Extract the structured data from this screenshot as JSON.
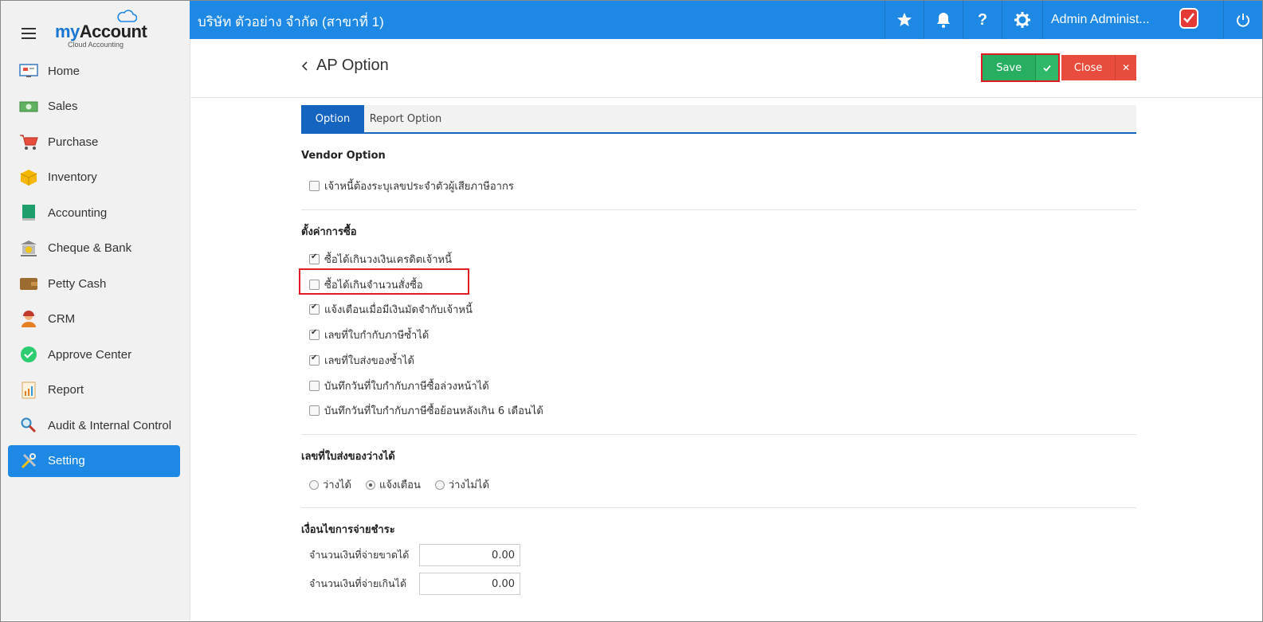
{
  "logo": {
    "brand_my": "my",
    "brand_account": "Account",
    "subtitle": "Cloud Accounting"
  },
  "sidebar": {
    "items": [
      {
        "label": "Home",
        "icon": "home-icon"
      },
      {
        "label": "Sales",
        "icon": "money-icon"
      },
      {
        "label": "Purchase",
        "icon": "cart-icon"
      },
      {
        "label": "Inventory",
        "icon": "box-icon"
      },
      {
        "label": "Accounting",
        "icon": "book-icon"
      },
      {
        "label": "Cheque & Bank",
        "icon": "bank-icon"
      },
      {
        "label": "Petty Cash",
        "icon": "wallet-icon"
      },
      {
        "label": "CRM",
        "icon": "person-icon"
      },
      {
        "label": "Approve Center",
        "icon": "check-circle-icon"
      },
      {
        "label": "Report",
        "icon": "report-icon"
      },
      {
        "label": "Audit & Internal Control",
        "icon": "magnifier-icon"
      },
      {
        "label": "Setting",
        "icon": "tools-icon",
        "active": true
      }
    ]
  },
  "topbar": {
    "company": "บริษัท ตัวอย่าง จำกัด (สาขาที่ 1)",
    "user_name": "Admin Administ..."
  },
  "header": {
    "title": "AP Option",
    "save_label": "Save",
    "close_label": "Close"
  },
  "tabs": [
    {
      "label": "Option",
      "active": true
    },
    {
      "label": "Report Option",
      "active": false
    }
  ],
  "vendor_option": {
    "title": "Vendor Option",
    "items": [
      {
        "label": "เจ้าหนี้ต้องระบุเลขประจำตัวผู้เสียภาษีอากร",
        "checked": false
      }
    ]
  },
  "purchase_settings": {
    "title": "ตั้งค่าการซื้อ",
    "items": [
      {
        "label": "ซื้อได้เกินวงเงินเครดิตเจ้าหนี้",
        "checked": true
      },
      {
        "label": "ซื้อได้เกินจำนวนสั่งซื้อ",
        "checked": false
      },
      {
        "label": "แจ้งเตือนเมื่อมีเงินมัดจำกับเจ้าหนี้",
        "checked": true
      },
      {
        "label": "เลขที่ใบกำกับภาษีซ้ำได้",
        "checked": true
      },
      {
        "label": "เลขที่ใบส่งของซ้ำได้",
        "checked": true
      },
      {
        "label": "บันทึกวันที่ใบกำกับภาษีซื้อล่วงหน้าได้",
        "checked": false
      },
      {
        "label": "บันทึกวันที่ใบกำกับภาษีซื้อย้อนหลังเกิน 6 เดือนได้",
        "checked": false
      }
    ]
  },
  "delivery_blank": {
    "title": "เลขที่ใบส่งของว่างได้",
    "options": [
      {
        "label": "ว่างได้",
        "selected": false
      },
      {
        "label": "แจ้งเตือน",
        "selected": true
      },
      {
        "label": "ว่างไม่ได้",
        "selected": false
      }
    ]
  },
  "payment_terms": {
    "title": "เงื่อนไขการจ่ายชำระ",
    "fields": [
      {
        "label": "จำนวนเงินที่จ่ายขาดได้",
        "value": "0.00"
      },
      {
        "label": "จำนวนเงินที่จ่ายเกินได้",
        "value": "0.00"
      }
    ]
  },
  "colors": {
    "primary": "#1e88e5",
    "save": "#27ae60",
    "close": "#e74c3c",
    "highlight": "#e01b24"
  }
}
